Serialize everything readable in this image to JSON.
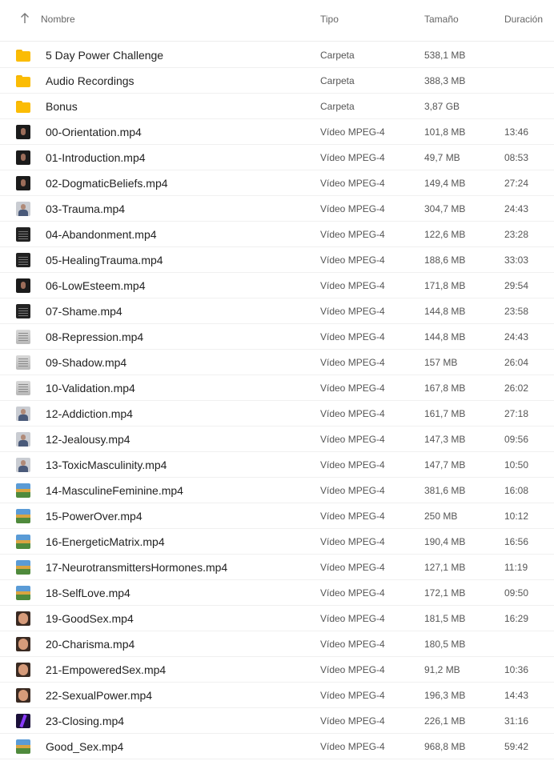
{
  "header": {
    "name": "Nombre",
    "type": "Tipo",
    "size": "Tamaño",
    "duration": "Duración",
    "sort_icon": "arrow-up-icon"
  },
  "rows": [
    {
      "name": "5 Day Power Challenge",
      "type": "Carpeta",
      "size": "538,1 MB",
      "duration": "",
      "icon": "folder"
    },
    {
      "name": "Audio Recordings",
      "type": "Carpeta",
      "size": "388,3 MB",
      "duration": "",
      "icon": "folder"
    },
    {
      "name": "Bonus",
      "type": "Carpeta",
      "size": "3,87 GB",
      "duration": "",
      "icon": "folder"
    },
    {
      "name": "00-Orientation.mp4",
      "type": "Vídeo MPEG-4",
      "size": "101,8 MB",
      "duration": "13:46",
      "icon": "dark"
    },
    {
      "name": "01-Introduction.mp4",
      "type": "Vídeo MPEG-4",
      "size": "49,7 MB",
      "duration": "08:53",
      "icon": "dark"
    },
    {
      "name": "02-DogmaticBeliefs.mp4",
      "type": "Vídeo MPEG-4",
      "size": "149,4 MB",
      "duration": "27:24",
      "icon": "dark"
    },
    {
      "name": "03-Trauma.mp4",
      "type": "Vídeo MPEG-4",
      "size": "304,7 MB",
      "duration": "24:43",
      "icon": "person"
    },
    {
      "name": "04-Abandonment.mp4",
      "type": "Vídeo MPEG-4",
      "size": "122,6 MB",
      "duration": "23:28",
      "icon": "screen"
    },
    {
      "name": "05-HealingTrauma.mp4",
      "type": "Vídeo MPEG-4",
      "size": "188,6 MB",
      "duration": "33:03",
      "icon": "screen"
    },
    {
      "name": "06-LowEsteem.mp4",
      "type": "Vídeo MPEG-4",
      "size": "171,8 MB",
      "duration": "29:54",
      "icon": "dark"
    },
    {
      "name": "07-Shame.mp4",
      "type": "Vídeo MPEG-4",
      "size": "144,8 MB",
      "duration": "23:58",
      "icon": "screen"
    },
    {
      "name": "08-Repression.mp4",
      "type": "Vídeo MPEG-4",
      "size": "144,8 MB",
      "duration": "24:43",
      "icon": "gray"
    },
    {
      "name": "09-Shadow.mp4",
      "type": "Vídeo MPEG-4",
      "size": "157 MB",
      "duration": "26:04",
      "icon": "gray"
    },
    {
      "name": "10-Validation.mp4",
      "type": "Vídeo MPEG-4",
      "size": "167,8 MB",
      "duration": "26:02",
      "icon": "gray"
    },
    {
      "name": "12-Addiction.mp4",
      "type": "Vídeo MPEG-4",
      "size": "161,7 MB",
      "duration": "27:18",
      "icon": "person"
    },
    {
      "name": "12-Jealousy.mp4",
      "type": "Vídeo MPEG-4",
      "size": "147,3 MB",
      "duration": "09:56",
      "icon": "person"
    },
    {
      "name": "13-ToxicMasculinity.mp4",
      "type": "Vídeo MPEG-4",
      "size": "147,7 MB",
      "duration": "10:50",
      "icon": "person"
    },
    {
      "name": "14-MasculineFeminine.mp4",
      "type": "Vídeo MPEG-4",
      "size": "381,6 MB",
      "duration": "16:08",
      "icon": "land"
    },
    {
      "name": "15-PowerOver.mp4",
      "type": "Vídeo MPEG-4",
      "size": "250 MB",
      "duration": "10:12",
      "icon": "land"
    },
    {
      "name": "16-EnergeticMatrix.mp4",
      "type": "Vídeo MPEG-4",
      "size": "190,4 MB",
      "duration": "16:56",
      "icon": "land"
    },
    {
      "name": "17-NeurotransmittersHormones.mp4",
      "type": "Vídeo MPEG-4",
      "size": "127,1 MB",
      "duration": "11:19",
      "icon": "land"
    },
    {
      "name": "18-SelfLove.mp4",
      "type": "Vídeo MPEG-4",
      "size": "172,1 MB",
      "duration": "09:50",
      "icon": "land"
    },
    {
      "name": "19-GoodSex.mp4",
      "type": "Vídeo MPEG-4",
      "size": "181,5 MB",
      "duration": "16:29",
      "icon": "face"
    },
    {
      "name": "20-Charisma.mp4",
      "type": "Vídeo MPEG-4",
      "size": "180,5 MB",
      "duration": "",
      "icon": "face"
    },
    {
      "name": "21-EmpoweredSex.mp4",
      "type": "Vídeo MPEG-4",
      "size": "91,2 MB",
      "duration": "10:36",
      "icon": "face"
    },
    {
      "name": "22-SexualPower.mp4",
      "type": "Vídeo MPEG-4",
      "size": "196,3 MB",
      "duration": "14:43",
      "icon": "face"
    },
    {
      "name": "23-Closing.mp4",
      "type": "Vídeo MPEG-4",
      "size": "226,1 MB",
      "duration": "31:16",
      "icon": "purple"
    },
    {
      "name": "Good_Sex.mp4",
      "type": "Vídeo MPEG-4",
      "size": "968,8 MB",
      "duration": "59:42",
      "icon": "land"
    }
  ]
}
